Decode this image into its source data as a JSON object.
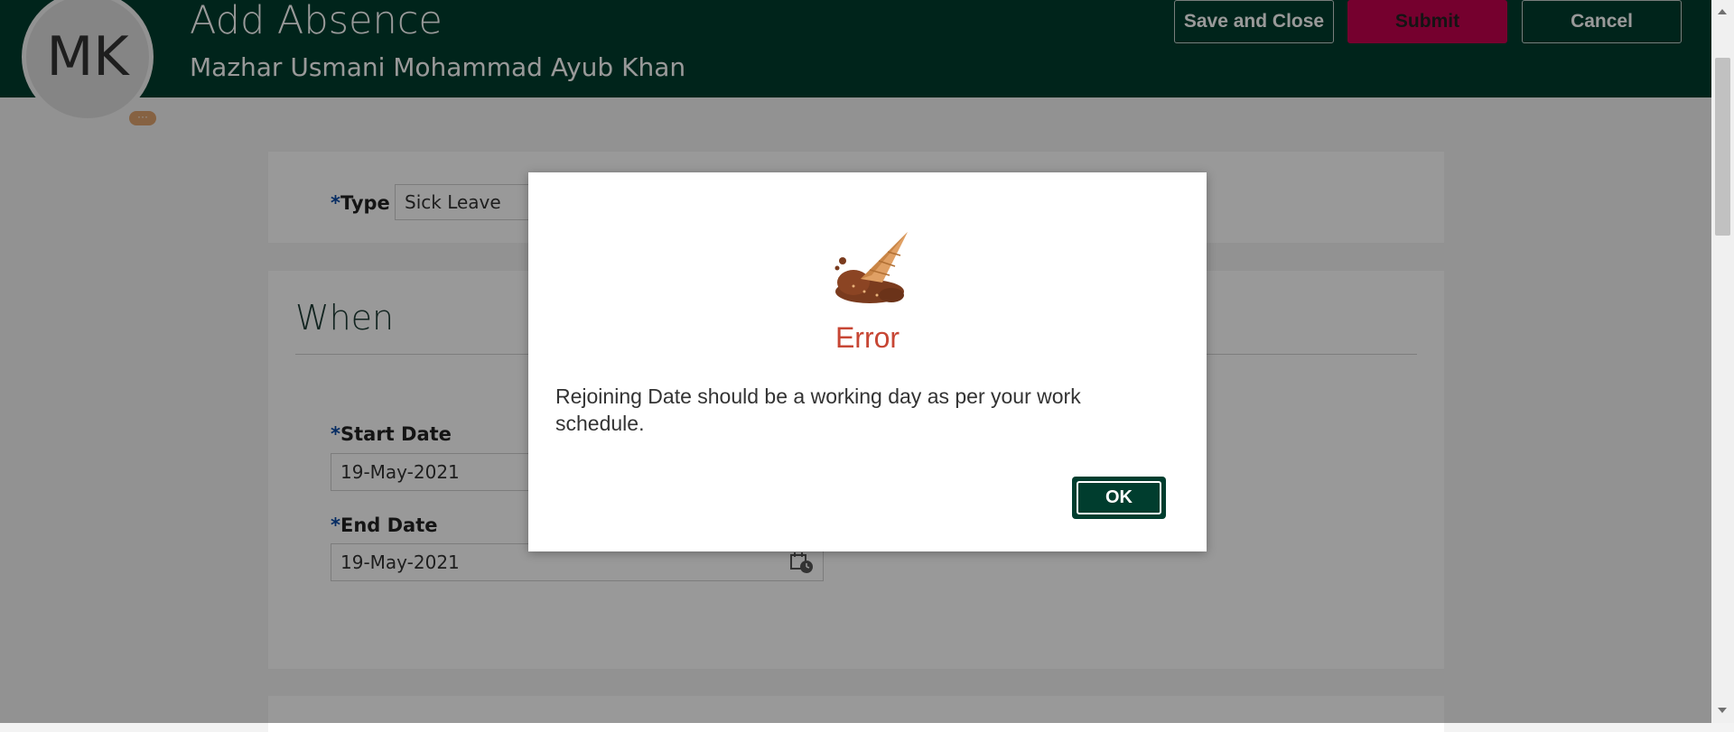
{
  "header": {
    "avatar_initials": "MK",
    "avatar_badge": "···",
    "title": "Add Absence",
    "employee_name": "Mazhar Usmani Mohammad Ayub Khan",
    "buttons": {
      "save_and_close": "Save and Close",
      "submit": "Submit",
      "cancel": "Cancel"
    }
  },
  "type_section": {
    "required_marker": "*",
    "label": "Type",
    "value": "Sick Leave"
  },
  "when_section": {
    "title": "When",
    "start_date": {
      "required_marker": "*",
      "label": "Start Date",
      "value": "19-May-2021"
    },
    "end_date": {
      "required_marker": "*",
      "label": "End Date",
      "value": "19-May-2021"
    }
  },
  "dialog": {
    "illustration": "dropped-ice-cream-cone",
    "title": "Error",
    "message": "Rejoining Date should be a working day as per your work schedule.",
    "ok_label": "OK"
  },
  "colors": {
    "header_bg": "#003d2e",
    "submit_bg": "#c3004e",
    "error_title": "#c74634",
    "required_marker": "#0a4aa6"
  }
}
